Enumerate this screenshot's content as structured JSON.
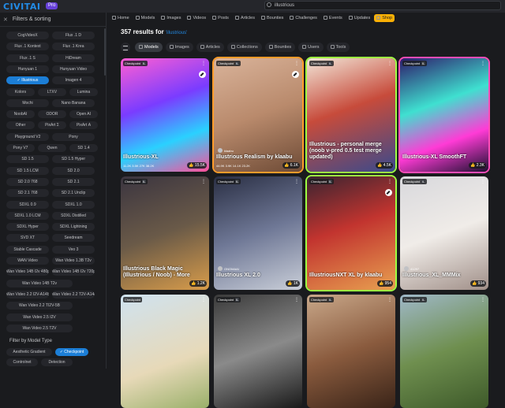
{
  "header": {
    "logo_main": "CIVIT",
    "logo_accent": "AI",
    "pro_badge": "Pro",
    "search_value": "illustrious"
  },
  "sidebar": {
    "title": "Filters & sorting",
    "base_models": [
      "CogVideoX",
      "Flux .1 D",
      "Flux .1 Kontext",
      "Flux .1 Krea",
      "Flux .1 S",
      "HiDream",
      "Hunyuan 1",
      "Hunyuan Video",
      "Illustrious",
      "Imagen 4",
      "Kolors",
      "LTXV",
      "Lumina",
      "Mochi",
      "Nano Banana",
      "NoobAI",
      "ODOR",
      "Open AI",
      "Other",
      "PixArt Σ",
      "PixArt Α",
      "Playground V2",
      "Pony",
      "Pony V7",
      "Qwen",
      "SD 1.4",
      "SD 1.5",
      "SD 1.5 Hyper",
      "SD 1.5 LCM",
      "SD 2.0",
      "SD 2.0 768",
      "SD 2.1",
      "SD 2.1 768",
      "SD 2.1 Unclip",
      "SDXL 0.9",
      "SDXL 1.0",
      "SDXL 1.0 LCM",
      "SDXL Distilled",
      "SDXL Hyper",
      "SDXL Lightning",
      "SVD XT",
      "Seedream",
      "Stable Cascade",
      "Veo 3",
      "WAN Video",
      "Wan Video 1.3B T2v",
      "Wan Video 14B I2v 480p",
      "Wan Video 14B I2v 720p",
      "Wan Video 14B T2v",
      "Wan Video 2.2 I2V-A14B",
      "Wan Video 2.2 T2V-A14B",
      "Wan Video 2.2 TI2V-5B",
      "Wan Video 2.5 I2V",
      "Wan Video 2.5 T2V"
    ],
    "model_type_title": "Filter by Model Type",
    "model_types": [
      "Aesthetic Gradient",
      "Checkpoint",
      "Controlnet",
      "Detection"
    ]
  },
  "nav": {
    "items": [
      "Home",
      "Models",
      "Images",
      "Videos",
      "Posts",
      "Articles",
      "Bounties",
      "Challenges",
      "Events",
      "Updates",
      "Shop"
    ]
  },
  "results": {
    "count_text": "357 results for",
    "query": "'illustrious'"
  },
  "tabs": [
    "Models",
    "Images",
    "Articles",
    "Collections",
    "Bounties",
    "Users",
    "Tools"
  ],
  "cards": [
    {
      "badge": "Checkpoint",
      "tag": "IL",
      "title": "Illustrious-XL",
      "stats": "11.2K  3.5K  27K  38.2K",
      "likes": "15.5K"
    },
    {
      "badge": "Checkpoint",
      "tag": "IL",
      "title": "Illustrious Realism by klaabu",
      "stats": "44.9K  3.9K  14.1K  23.2K",
      "likes": "6.1K",
      "creator": "klaabu"
    },
    {
      "badge": "Checkpoint",
      "tag": "IL",
      "title": "Illustrious - personal merge (noob v-pred 0.5 test merge updated)",
      "stats": "",
      "likes": "4.5K"
    },
    {
      "badge": "Checkpoint",
      "tag": "IL",
      "title": "Illustrious-XL SmoothFT",
      "stats": "",
      "likes": "2.3K"
    },
    {
      "badge": "Checkpoint",
      "tag": "IL",
      "title": "Illustrious Black Magic (Illustrious / Noob) - More",
      "stats": "",
      "likes": "1.2K"
    },
    {
      "badge": "Checkpoint",
      "tag": "IL",
      "title": "Illustrious XL 2.0",
      "stats": "",
      "likes": "1K",
      "creator": "ONOMAAI"
    },
    {
      "badge": "Checkpoint",
      "tag": "IL",
      "title": "IllustriousNXT XL by klaabu",
      "stats": "",
      "likes": "954"
    },
    {
      "badge": "Checkpoint",
      "tag": "IL",
      "title": "Illustrious_XL_MMMix",
      "stats": "",
      "likes": "934",
      "creator": "41297"
    },
    {
      "badge": "Checkpoint",
      "tag": "",
      "title": "",
      "stats": "",
      "likes": ""
    },
    {
      "badge": "Checkpoint",
      "tag": "IL",
      "title": "",
      "stats": "",
      "likes": ""
    },
    {
      "badge": "Checkpoint",
      "tag": "IL",
      "title": "",
      "stats": "",
      "likes": ""
    },
    {
      "badge": "Checkpoint",
      "tag": "IL",
      "title": "",
      "stats": "",
      "likes": ""
    }
  ]
}
